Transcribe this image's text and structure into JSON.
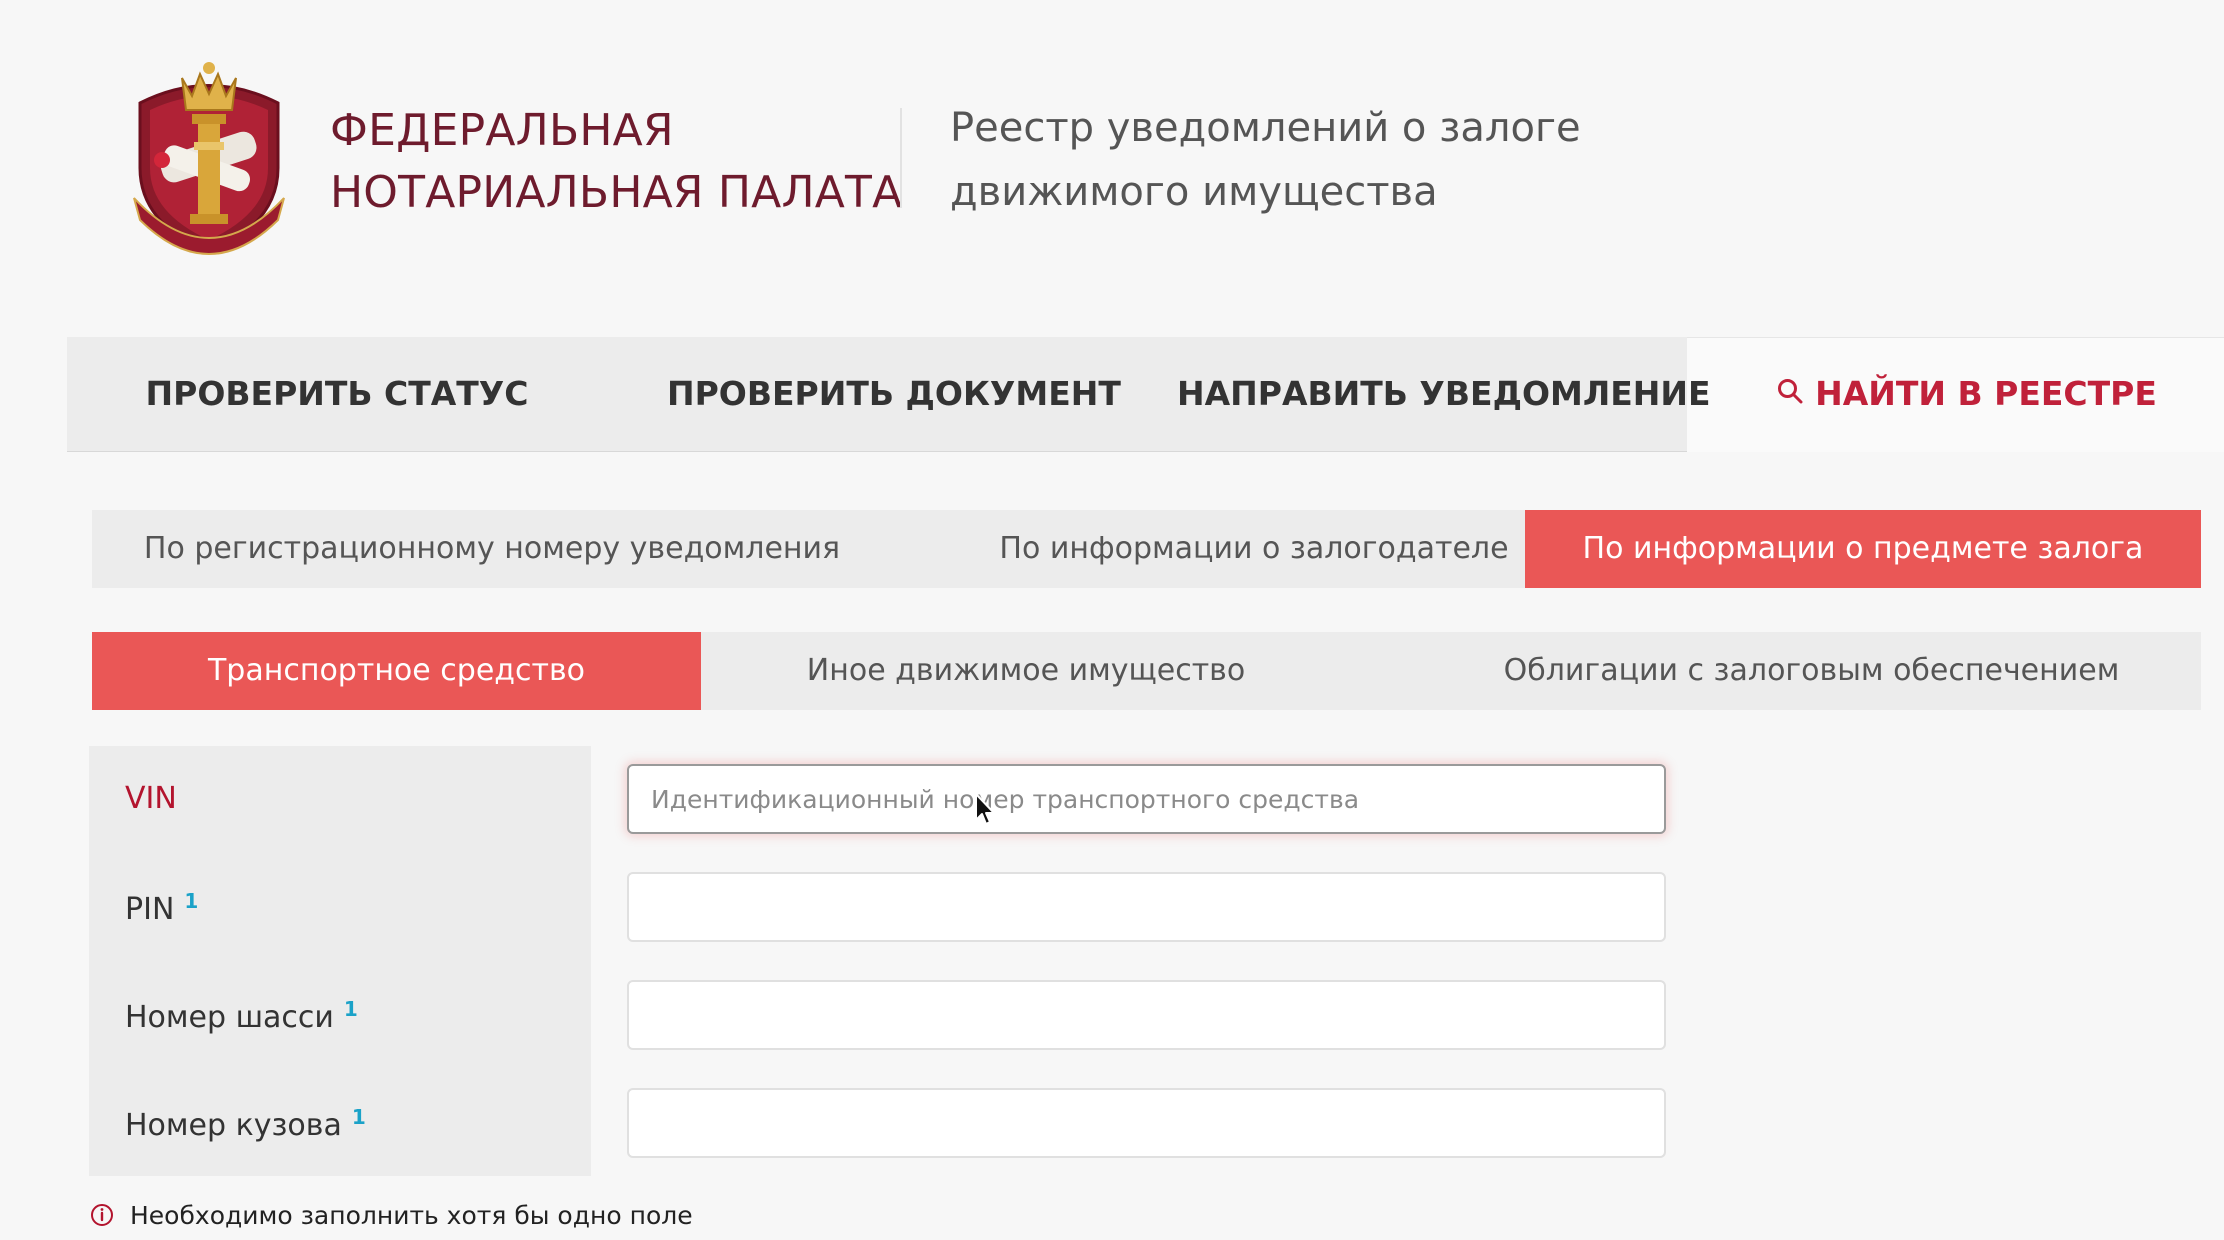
{
  "header": {
    "org_name_line1": "ФЕДЕРАЛЬНАЯ",
    "org_name_line2": "НОТАРИАЛЬНАЯ ПАЛАТА",
    "registry_title_line1": "Реестр уведомлений о залоге",
    "registry_title_line2": "движимого имущества"
  },
  "main_nav": {
    "items": [
      {
        "label": "ПРОВЕРИТЬ СТАТУС"
      },
      {
        "label": "ПРОВЕРИТЬ ДОКУМЕНТ"
      },
      {
        "label": "НАПРАВИТЬ УВЕДОМЛЕНИЕ"
      },
      {
        "label": "НАЙТИ В РЕЕСТРЕ",
        "active": true,
        "icon": "search-icon"
      }
    ]
  },
  "search_tabs": [
    {
      "label": "По регистрационному номеру уведомления"
    },
    {
      "label": "По информации о залогодателе"
    },
    {
      "label": "По информации о предмете залога",
      "active": true
    }
  ],
  "subject_tabs": [
    {
      "label": "Транспортное средство",
      "active": true
    },
    {
      "label": "Иное движимое имущество"
    },
    {
      "label": "Облигации с залоговым обеспечением"
    }
  ],
  "form": {
    "fields": [
      {
        "label": "VIN",
        "footnote": "",
        "value": "",
        "placeholder": "Идентификационный номер транспортного средства",
        "focused": true
      },
      {
        "label": "PIN",
        "footnote": "1",
        "value": "",
        "placeholder": ""
      },
      {
        "label": "Номер шасси",
        "footnote": "1",
        "value": "",
        "placeholder": ""
      },
      {
        "label": "Номер кузова",
        "footnote": "1",
        "value": "",
        "placeholder": ""
      }
    ],
    "notice": "Необходимо заполнить хотя бы одно поле"
  },
  "colors": {
    "brand_dark": "#6e1b2d",
    "accent_red": "#ea5756",
    "active_nav": "#c0213a",
    "footnote_blue": "#1ba2c8"
  }
}
